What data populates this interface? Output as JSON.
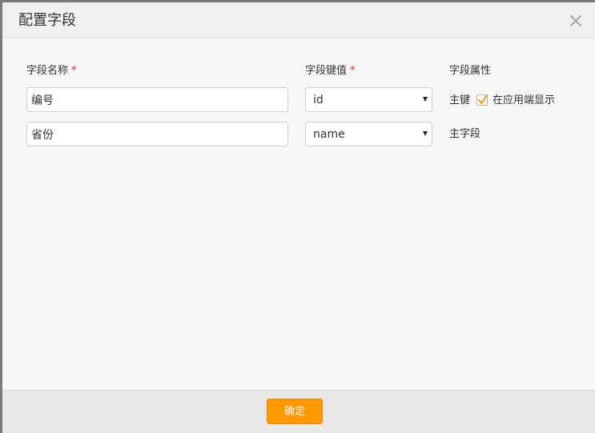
{
  "dialog": {
    "title": "配置字段",
    "close_icon": "close-icon"
  },
  "columns": {
    "field_name": "字段名称",
    "field_key": "字段键值",
    "field_attr": "字段属性",
    "required_mark": "*"
  },
  "rows": [
    {
      "name_value": "编号",
      "key_value": "id",
      "attr_label": "主键",
      "checkbox_checked": true,
      "checkbox_label": "在应用端显示"
    },
    {
      "name_value": "省份",
      "key_value": "name",
      "attr_label": "主字段"
    }
  ],
  "footer": {
    "confirm_label": "确定"
  },
  "colors": {
    "accent": "#ff9800",
    "required": "#e0262d"
  }
}
